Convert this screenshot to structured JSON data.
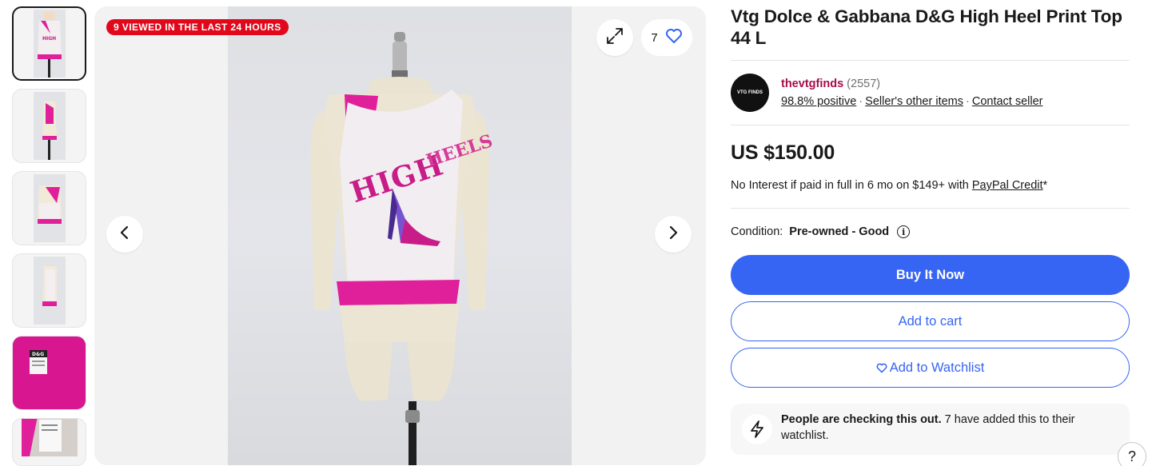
{
  "thumbnails": [
    {
      "alt": "front",
      "color": "#e9e9ee"
    },
    {
      "alt": "side",
      "color": "#e9e9ee"
    },
    {
      "alt": "back",
      "color": "#e9e9ee"
    },
    {
      "alt": "side-2",
      "color": "#e9e9ee"
    },
    {
      "alt": "label",
      "color": "#d8168f",
      "label_text": "D&G"
    },
    {
      "alt": "tag",
      "color": "#e9e9ee"
    }
  ],
  "gallery": {
    "badge": "9 VIEWED IN THE LAST 24 HOURS",
    "watch_count": "7",
    "shirt_print": "HIGH HEELS",
    "colors": {
      "badge": "#e0081a",
      "heart": "#3665f3",
      "pink": "#e0209b"
    }
  },
  "listing": {
    "title": "Vtg Dolce & Gabbana D&G High Heel Print Top 44 L",
    "seller": {
      "logo_text": "VTG FINDS",
      "name": "thevtgfinds",
      "feedback_count": "(2557)",
      "positive": "98.8% positive",
      "other_items": "Seller's other items",
      "contact": "Contact seller"
    },
    "price": "US $150.00",
    "credit": {
      "prefix": "No Interest if paid in full in 6 mo on $149+ with ",
      "link": "PayPal Credit",
      "suffix": "*"
    },
    "condition": {
      "label": "Condition:",
      "value": "Pre-owned - Good"
    },
    "buttons": {
      "buy": "Buy It Now",
      "cart": "Add to cart",
      "watch": "Add to Watchlist"
    },
    "alert": {
      "bold": "People are checking this out.",
      "text": " 7 have added this to their watchlist."
    },
    "help": "?"
  },
  "accent": "#3665f3",
  "seller_color": "#a80c4a"
}
